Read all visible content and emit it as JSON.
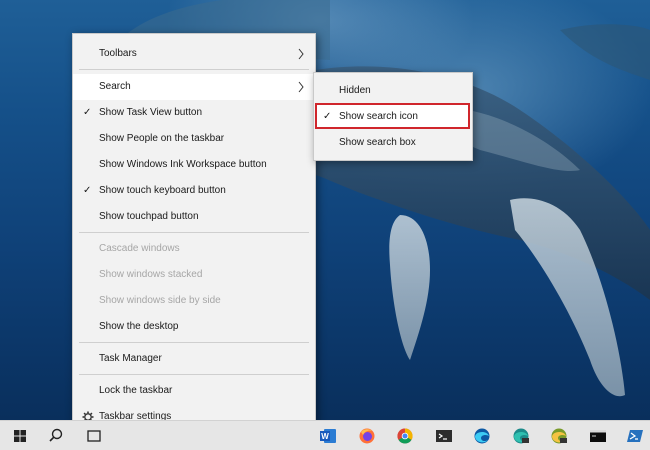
{
  "context_menu": {
    "toolbars": "Toolbars",
    "search": "Search",
    "show_task_view": "Show Task View button",
    "show_people": "Show People on the taskbar",
    "show_ink": "Show Windows Ink Workspace button",
    "show_touch_keyboard": "Show touch keyboard button",
    "show_touchpad": "Show touchpad button",
    "cascade": "Cascade windows",
    "stacked": "Show windows stacked",
    "side_by_side": "Show windows side by side",
    "show_desktop": "Show the desktop",
    "task_manager": "Task Manager",
    "lock_taskbar": "Lock the taskbar",
    "taskbar_settings": "Taskbar settings",
    "check_glyph": "✓"
  },
  "search_submenu": {
    "hidden": "Hidden",
    "show_icon": "Show search icon",
    "show_box": "Show search box",
    "selected": "Show search icon",
    "check_glyph": "✓"
  },
  "taskbar": {
    "icons": [
      "windows-start-icon",
      "search-icon",
      "task-view-icon",
      "word-icon",
      "firefox-icon",
      "chrome-icon",
      "terminal-icon",
      "edge-icon",
      "edge-dev-icon",
      "edge-canary-icon",
      "cmd-icon",
      "powershell-icon"
    ]
  },
  "colors": {
    "highlight_border": "#d0262c",
    "menu_background": "#f2f2f2",
    "taskbar_background": "#e6e6e6"
  }
}
